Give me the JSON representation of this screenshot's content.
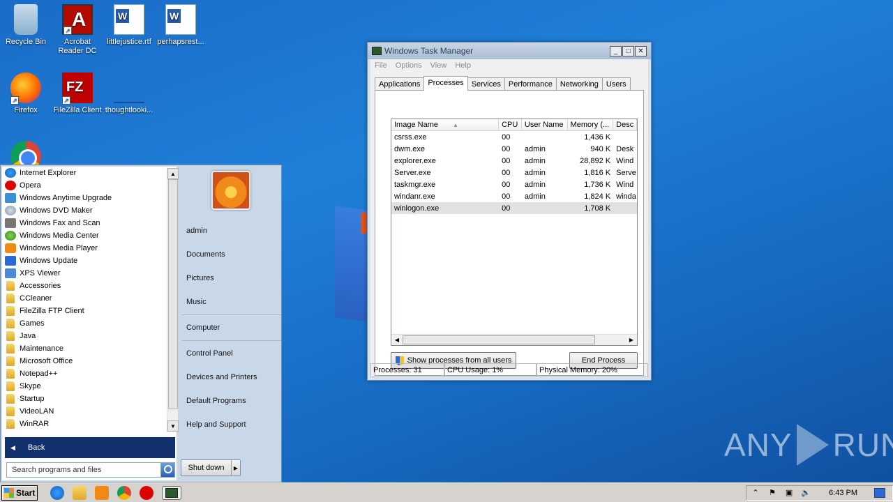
{
  "desktop": {
    "icons": [
      {
        "label": "Recycle Bin",
        "icon": "recycle-bin-icon"
      },
      {
        "label": "Acrobat Reader DC",
        "icon": "acrobat-icon"
      },
      {
        "label": "littlejustice.rtf",
        "icon": "word-document-icon"
      },
      {
        "label": "perhapsrest...",
        "icon": "word-document-icon"
      },
      {
        "label": "Firefox",
        "icon": "firefox-icon"
      },
      {
        "label": "FileZilla Client",
        "icon": "filezilla-icon"
      },
      {
        "label": "thoughtlooki...",
        "icon": "file-icon"
      },
      {
        "label": "",
        "icon": "chrome-icon"
      }
    ],
    "watermark": {
      "left": "ANY",
      "right": "RUN"
    }
  },
  "task_manager": {
    "title": "Windows Task Manager",
    "menu": [
      "File",
      "Options",
      "View",
      "Help"
    ],
    "tabs": [
      "Applications",
      "Processes",
      "Services",
      "Performance",
      "Networking",
      "Users"
    ],
    "active_tab": "Processes",
    "columns": [
      "Image Name",
      "CPU",
      "User Name",
      "Memory (...",
      "Desc"
    ],
    "rows": [
      {
        "name": "csrss.exe",
        "cpu": "00",
        "user": "",
        "mem": "1,436 K",
        "desc": ""
      },
      {
        "name": "dwm.exe",
        "cpu": "00",
        "user": "admin",
        "mem": "940 K",
        "desc": "Desk"
      },
      {
        "name": "explorer.exe",
        "cpu": "00",
        "user": "admin",
        "mem": "28,892 K",
        "desc": "Wind"
      },
      {
        "name": "Server.exe",
        "cpu": "00",
        "user": "admin",
        "mem": "1,816 K",
        "desc": "Serve"
      },
      {
        "name": "taskmgr.exe",
        "cpu": "00",
        "user": "admin",
        "mem": "1,736 K",
        "desc": "Wind"
      },
      {
        "name": "windanr.exe",
        "cpu": "00",
        "user": "admin",
        "mem": "1,824 K",
        "desc": "winda"
      },
      {
        "name": "winlogon.exe",
        "cpu": "00",
        "user": "",
        "mem": "1,708 K",
        "desc": ""
      }
    ],
    "selected_row": "winlogon.exe",
    "show_all_label": "Show processes from all users",
    "end_process_label": "End Process",
    "status": {
      "processes": "Processes: 31",
      "cpu": "CPU Usage: 1%",
      "memory": "Physical Memory: 20%"
    }
  },
  "start_menu": {
    "programs": [
      {
        "label": "Internet Explorer",
        "icon": "ie"
      },
      {
        "label": "Opera",
        "icon": "opera"
      },
      {
        "label": "Windows Anytime Upgrade",
        "icon": "upgrade"
      },
      {
        "label": "Windows DVD Maker",
        "icon": "dvd"
      },
      {
        "label": "Windows Fax and Scan",
        "icon": "fax"
      },
      {
        "label": "Windows Media Center",
        "icon": "media"
      },
      {
        "label": "Windows Media Player",
        "icon": "player"
      },
      {
        "label": "Windows Update",
        "icon": "update"
      },
      {
        "label": "XPS Viewer",
        "icon": "xps"
      },
      {
        "label": "Accessories",
        "icon": "folder"
      },
      {
        "label": "CCleaner",
        "icon": "folder"
      },
      {
        "label": "FileZilla FTP Client",
        "icon": "folder"
      },
      {
        "label": "Games",
        "icon": "folder"
      },
      {
        "label": "Java",
        "icon": "folder"
      },
      {
        "label": "Maintenance",
        "icon": "folder"
      },
      {
        "label": "Microsoft Office",
        "icon": "folder"
      },
      {
        "label": "Notepad++",
        "icon": "folder"
      },
      {
        "label": "Skype",
        "icon": "folder"
      },
      {
        "label": "Startup",
        "icon": "folder"
      },
      {
        "label": "VideoLAN",
        "icon": "folder"
      },
      {
        "label": "WinRAR",
        "icon": "folder"
      }
    ],
    "back_label": "Back",
    "search_placeholder": "Search programs and files",
    "right_links": [
      "admin",
      "Documents",
      "Pictures",
      "Music",
      "Computer",
      "Control Panel",
      "Devices and Printers",
      "Default Programs",
      "Help and Support"
    ],
    "shutdown_label": "Shut down"
  },
  "taskbar": {
    "start_label": "Start",
    "pinned": [
      "internet-explorer-icon",
      "explorer-folder-icon",
      "media-player-icon",
      "chrome-icon",
      "opera-icon",
      "task-manager-icon"
    ],
    "clock": "6:43 PM"
  }
}
